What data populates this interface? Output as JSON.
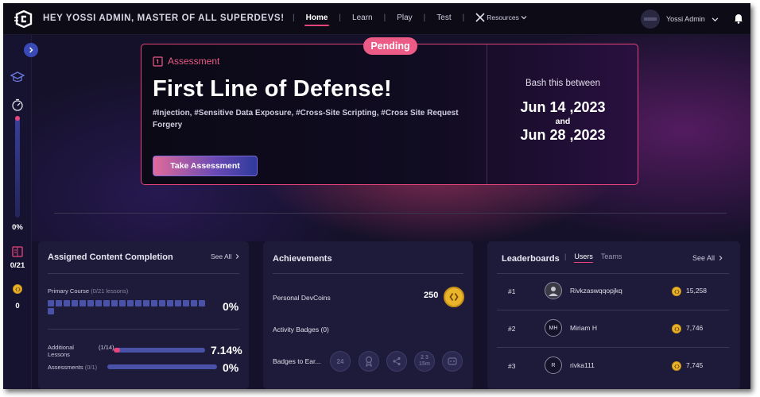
{
  "header": {
    "greeting": "HEY YOSSI ADMIN, MASTER OF ALL SUPERDEVS!",
    "nav": [
      {
        "label": "Home",
        "active": true
      },
      {
        "label": "Learn"
      },
      {
        "label": "Play"
      },
      {
        "label": "Test"
      }
    ],
    "resources_label": "Resources",
    "user_name": "Yossi Admin"
  },
  "rail": {
    "progress_pct": "0%",
    "progress_value": 0,
    "lessons": "0/21",
    "coins": "0"
  },
  "hero": {
    "status": "Pending",
    "kind": "Assessment",
    "title": "First Line of Defense!",
    "tags": "#Injection, #Sensitive Data Exposure, #Cross-Site Scripting, #Cross Site Request Forgery",
    "button": "Take Assessment",
    "bash_label": "Bash this between",
    "start_date": "Jun 14 ,2023",
    "and": "and",
    "end_date": "Jun 28 ,2023"
  },
  "assigned": {
    "title": "Assigned Content Completion",
    "see_all": "See All",
    "primary_label": "Primary Course",
    "primary_count": "(0/21 lessons)",
    "primary_pct": "0%",
    "primary_total": 21,
    "primary_done": 0,
    "additional_label": "Additional Lessons",
    "additional_count": "(1/14)",
    "additional_pct": "7.14%",
    "additional_fraction": 0.0714,
    "assessments_label": "Assessments",
    "assessments_count": "(0/1)",
    "assessments_pct": "0%",
    "assessments_fraction": 0
  },
  "achievements": {
    "title": "Achievements",
    "devcoins_label": "Personal DevCoins",
    "devcoins_value": "250",
    "activity_label": "Activity Badges (0)",
    "badges_label": "Badges to Ear...",
    "badge_24": "24",
    "badge_time_top": "2 3",
    "badge_time_bottom": "15m"
  },
  "leaderboard": {
    "title": "Leaderboards",
    "tab_users": "Users",
    "tab_teams": "Teams",
    "see_all": "See All",
    "rows": [
      {
        "rank": "#1",
        "initials": "",
        "name": "Rivkzaswqqopjkq",
        "score": "15,258"
      },
      {
        "rank": "#2",
        "initials": "MH",
        "name": "Miriam H",
        "score": "7,746"
      },
      {
        "rank": "#3",
        "initials": "R",
        "name": "rivka111",
        "score": "7,745"
      }
    ]
  },
  "colors": {
    "accent": "#e8447b",
    "background": "#15112a",
    "panel": "#1e1b3a",
    "coin": "#e9b52a"
  }
}
